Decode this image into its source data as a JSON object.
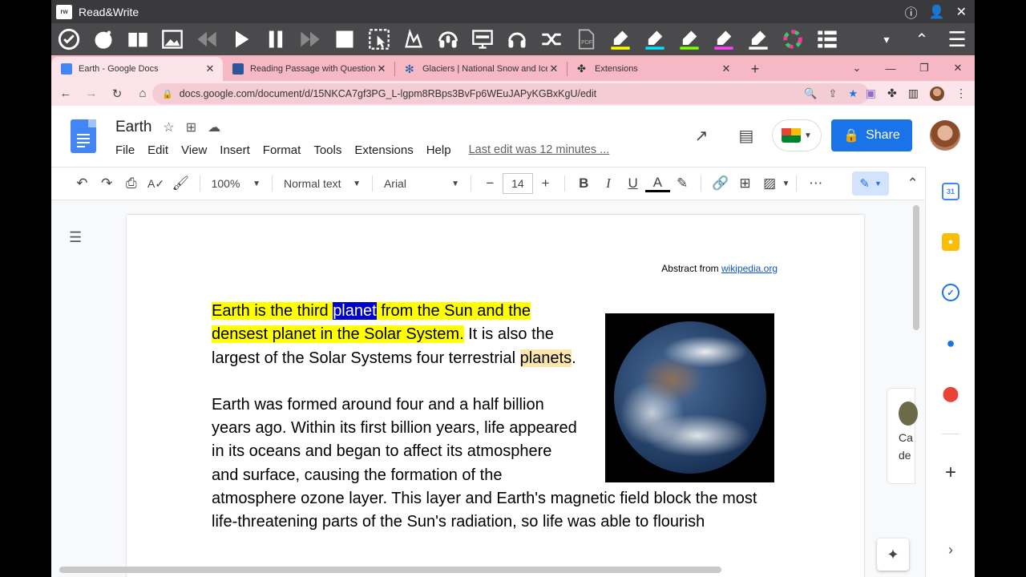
{
  "rw": {
    "title": "Read&Write",
    "logo_text": "rw",
    "toolbar_icons": [
      "check-icon",
      "prediction-icon",
      "dictionary-icon",
      "picture-dictionary-icon",
      "rewind-icon",
      "play-icon",
      "pause-icon",
      "forward-icon",
      "stop-icon",
      "screenshot-reader-icon",
      "audio-maker-icon",
      "speech-input-icon",
      "screen-mask-icon",
      "talk-typer-icon",
      "translator-icon",
      "pdf-icon",
      "highlight-yellow-icon",
      "highlight-blue-icon",
      "highlight-green-icon",
      "highlight-pink-icon",
      "clear-highlights-icon",
      "collect-highlights-icon",
      "vocabulary-icon"
    ],
    "dropdown": "▾",
    "collapse": "⌃",
    "menu": "☰"
  },
  "tabs": [
    {
      "title": "Earth - Google Docs",
      "color": "#4285f4"
    },
    {
      "title": "Reading Passage with Questions",
      "color": "#2b579a"
    },
    {
      "title": "Glaciers | National Snow and Ice Data Center",
      "color": "#1a5fa6"
    },
    {
      "title": "Extensions",
      "color": "#555555"
    }
  ],
  "window": {
    "chevron": "⌄",
    "minimize": "—",
    "restore": "❐",
    "close": "✕"
  },
  "address": {
    "url": "docs.google.com/document/d/15NKCA7gf3PG_L-lgpm8RBps3BvFp6WEuJAPyKGBxKgU/edit"
  },
  "docs": {
    "title": "Earth",
    "menu": [
      "File",
      "Edit",
      "View",
      "Insert",
      "Format",
      "Tools",
      "Extensions",
      "Help"
    ],
    "last_edit": "Last edit was 12 minutes ...",
    "share": "Share"
  },
  "toolbar": {
    "zoom": "100%",
    "style": "Normal text",
    "font": "Arial",
    "font_size": "14"
  },
  "document": {
    "abstract_prefix": "Abstract from ",
    "abstract_link": "wikipedia.org",
    "p1_hl_a": "Earth is the third ",
    "p1_hl_word": "planet",
    "p1_hl_b": " from the Sun and the densest planet in the Solar System.",
    "p1_rest": " It is also the largest of the Solar Systems four terrestrial ",
    "p1_soft": "planets",
    "p1_end": ".",
    "p2": "Earth was formed around four and a half billion years ago. Within its first billion years, life appeared in its oceans and began to affect its atmosphere and surface, causing the formation of the atmosphere ozone layer. This layer and Earth's magnetic field block the most life-threatening parts of the Sun's radiation, so life was able to flourish",
    "suggestion_text": "Ca de"
  },
  "colors": {
    "rw_bar": "#4a4a4c",
    "tab_strip": "#f5b8c4",
    "share_blue": "#1a73e8",
    "highlight_yellow": "#ffff00",
    "highlight_word": "#0000cc"
  }
}
